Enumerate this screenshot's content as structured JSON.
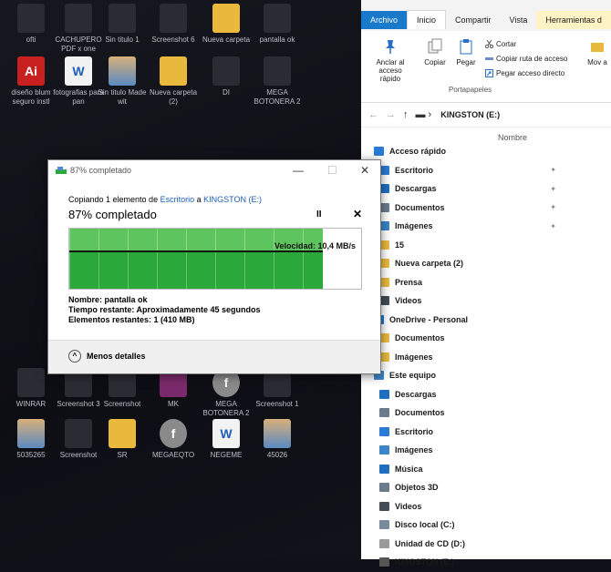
{
  "desktop": {
    "icons": [
      {
        "label": "ofti",
        "kind": "dark"
      },
      {
        "label": "CACHUPERO PDF x one",
        "kind": "dark"
      },
      {
        "label": "Sin titulo 1",
        "kind": "dark"
      },
      {
        "label": "Screenshot 6",
        "kind": "dark"
      },
      {
        "label": "Nueva carpeta",
        "kind": "folder"
      },
      {
        "label": "pantalla ok",
        "kind": "dark"
      },
      {
        "label": "diseño blum seguro instl",
        "kind": "ai"
      },
      {
        "label": "fotografias para pan",
        "kind": "word"
      },
      {
        "label": "Sin titulo Made wit",
        "kind": "img"
      },
      {
        "label": "Nueva carpeta (2)",
        "kind": "folder"
      },
      {
        "label": "DI",
        "kind": "dark"
      },
      {
        "label": "MEGA BOTONERA 2",
        "kind": "dark"
      },
      {
        "label": "WINRAR",
        "kind": "dark"
      },
      {
        "label": "Screenshot 3",
        "kind": "dark"
      },
      {
        "label": "Screenshot",
        "kind": "dark"
      },
      {
        "label": "MK",
        "kind": "winrar"
      },
      {
        "label": "MEGA BOTONERA 2",
        "kind": "flash"
      },
      {
        "label": "Screenshot 1",
        "kind": "dark"
      },
      {
        "label": "5035265",
        "kind": "img"
      },
      {
        "label": "Screenshot",
        "kind": "dark"
      },
      {
        "label": "SR",
        "kind": "folder"
      },
      {
        "label": "MEGAEQTO",
        "kind": "flash"
      },
      {
        "label": "NEGEME",
        "kind": "word"
      },
      {
        "label": "45026",
        "kind": "img"
      }
    ]
  },
  "explorer": {
    "tabs": [
      "Archivo",
      "Inicio",
      "Compartir",
      "Vista",
      "Herramientas d"
    ],
    "ribbon": {
      "pin_label": "Anclar al acceso rápido",
      "copy_label": "Copiar",
      "paste_label": "Pegar",
      "cut_label": "Cortar",
      "copy_path_label": "Copiar ruta de acceso",
      "paste_shortcut_label": "Pegar acceso directo",
      "move_label": "Mov a",
      "group_label": "Portapapeles"
    },
    "address": "KINGSTON (E:)",
    "column_header": "Nombre",
    "tree": [
      {
        "label": "Acceso rápido",
        "color": "#2a7bd5",
        "sub": false,
        "pin": false
      },
      {
        "label": "Escritorio",
        "color": "#2a7bd5",
        "sub": true,
        "pin": true
      },
      {
        "label": "Descargas",
        "color": "#1f6fc0",
        "sub": true,
        "pin": true
      },
      {
        "label": "Documentos",
        "color": "#6b7b8c",
        "sub": true,
        "pin": true
      },
      {
        "label": "Imágenes",
        "color": "#3a86c8",
        "sub": true,
        "pin": true
      },
      {
        "label": "15",
        "color": "#e9b93d",
        "sub": true,
        "pin": false
      },
      {
        "label": "Nueva carpeta (2)",
        "color": "#e9b93d",
        "sub": true,
        "pin": false
      },
      {
        "label": "Prensa",
        "color": "#e9b93d",
        "sub": true,
        "pin": false
      },
      {
        "label": "Videos",
        "color": "#444c56",
        "sub": true,
        "pin": false
      },
      {
        "label": "OneDrive - Personal",
        "color": "#1f78d1",
        "sub": false,
        "pin": false
      },
      {
        "label": "Documentos",
        "color": "#e9b93d",
        "sub": true,
        "pin": false
      },
      {
        "label": "Imágenes",
        "color": "#e9b93d",
        "sub": true,
        "pin": false
      },
      {
        "label": "Este equipo",
        "color": "#3a86c8",
        "sub": false,
        "pin": false
      },
      {
        "label": "Descargas",
        "color": "#1f6fc0",
        "sub": true,
        "pin": false
      },
      {
        "label": "Documentos",
        "color": "#6b7b8c",
        "sub": true,
        "pin": false
      },
      {
        "label": "Escritorio",
        "color": "#2a7bd5",
        "sub": true,
        "pin": false
      },
      {
        "label": "Imágenes",
        "color": "#3a86c8",
        "sub": true,
        "pin": false
      },
      {
        "label": "Música",
        "color": "#1f6fc0",
        "sub": true,
        "pin": false
      },
      {
        "label": "Objetos 3D",
        "color": "#6b7b8c",
        "sub": true,
        "pin": false
      },
      {
        "label": "Videos",
        "color": "#444c56",
        "sub": true,
        "pin": false
      },
      {
        "label": "Disco local (C:)",
        "color": "#7a8a9a",
        "sub": true,
        "pin": false
      },
      {
        "label": "Unidad de CD (D:)",
        "color": "#9a9a9a",
        "sub": true,
        "pin": false
      },
      {
        "label": "KINGSTON (E:)",
        "color": "#555",
        "sub": true,
        "pin": false
      }
    ]
  },
  "dialog": {
    "title": "87% completado",
    "copy_prefix": "Copiando 1 elemento de ",
    "source": "Escritorio",
    "to_word": " a ",
    "destination": "KINGSTON (E:)",
    "percent_text": "87% completado",
    "progress": 0.87,
    "speed": "Velocidad: 10,4 MB/s",
    "name_line": "Nombre: pantalla ok",
    "time_line": "Tiempo restante: Aproximadamente 45 segundos",
    "items_line": "Elementos restantes: 1 (410 MB)",
    "less_details": "Menos detalles",
    "pause_symbol": "II",
    "cancel_symbol": "✕",
    "minimize_symbol": "—",
    "maximize_symbol": "☐",
    "close_symbol": "✕",
    "accent": "#2aa83a"
  }
}
